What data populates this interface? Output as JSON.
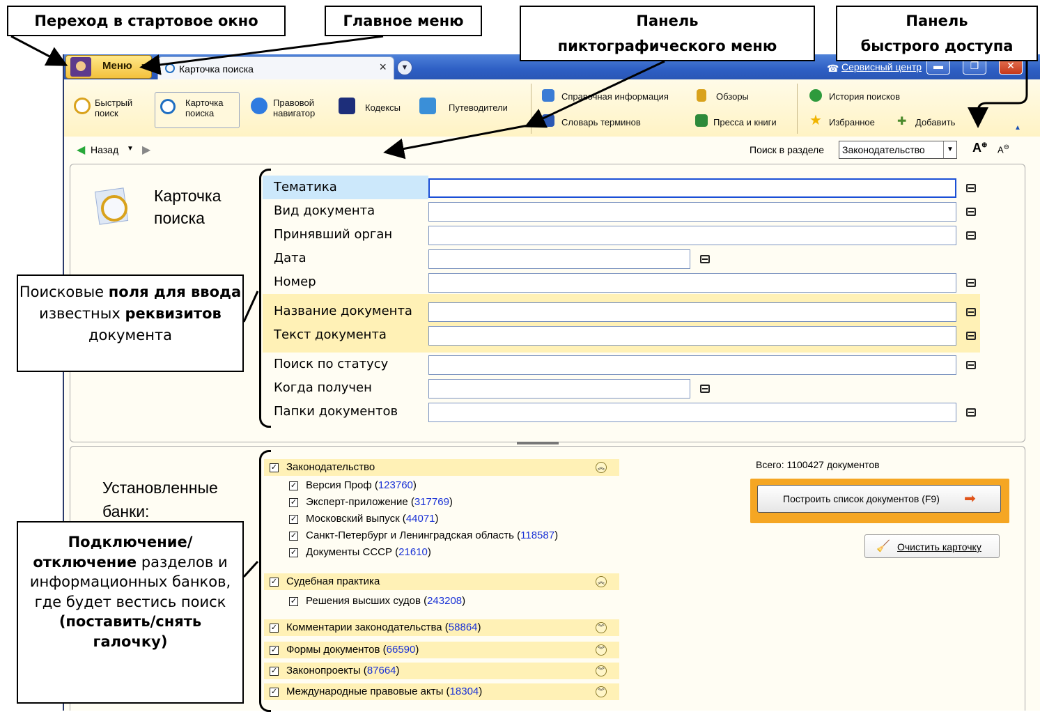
{
  "callouts": {
    "start_window": "Переход в стартовое окно",
    "main_menu": "Главное меню",
    "pictograph_panel": "Панель\nпиктографического меню",
    "quick_access": "Панель\nбыстрого доступа",
    "fields": {
      "p1": "Поисковые ",
      "b1": "поля для ввода",
      "p2": " известных ",
      "b2": "реквизитов",
      "p3": " документа"
    },
    "banks": {
      "b1": "Подключение/ отключение",
      "p1": " разделов и информационных банков, где будет вестись поиск ",
      "b2": "(поставить/снять галочку)"
    }
  },
  "titlebar": {
    "menu_label": "Меню",
    "tab_title": "Карточка поиска",
    "tab_close": "×",
    "service_center": "Сервисный центр"
  },
  "ribbon": {
    "quick_search": "Быстрый поиск",
    "search_card": "Карточка поиска",
    "legal_navigator": "Правовой навигатор",
    "codes": "Кодексы",
    "guides": "Путеводители",
    "reference_info": "Справочная информация",
    "terms_dictionary": "Словарь терминов",
    "reviews": "Обзоры",
    "press_books": "Пресса и книги",
    "search_history": "История поисков",
    "favorites": "Избранное",
    "add": "Добавить"
  },
  "nav": {
    "back": "Назад",
    "search_in_section_label": "Поиск в разделе",
    "section_value": "Законодательство"
  },
  "search_card": {
    "title_line1": "Карточка",
    "title_line2": "поиска",
    "fields": [
      "Тематика",
      "Вид документа",
      "Принявший орган",
      "Дата",
      "Номер",
      "Название документа",
      "Текст документа",
      "Поиск по статусу",
      "Когда получен",
      "Папки документов"
    ]
  },
  "banks": {
    "title_line1": "Установленные",
    "title_line2": "банки:",
    "total": "Всего: 1100427 документов",
    "build_button": "Построить список документов (F9)",
    "clear_button": "Очистить карточку",
    "groups": [
      {
        "name": "Законодательство",
        "count": ""
      },
      {
        "name": "Судебная практика",
        "count": ""
      },
      {
        "name": "Комментарии законодательства",
        "count": "58864"
      },
      {
        "name": "Формы документов",
        "count": "66590"
      },
      {
        "name": "Законопроекты",
        "count": "87664"
      },
      {
        "name": "Международные правовые акты",
        "count": "18304"
      }
    ],
    "sub": [
      {
        "name": "Версия Проф",
        "count": "123760"
      },
      {
        "name": "Эксперт-приложение",
        "count": "317769"
      },
      {
        "name": "Московский выпуск",
        "count": "44071"
      },
      {
        "name": "Санкт-Петербург и Ленинградская область",
        "count": "118587"
      },
      {
        "name": "Документы СССР",
        "count": "21610"
      },
      {
        "name": "Решения высших судов",
        "count": "243208"
      }
    ]
  },
  "colors": {
    "titlebar": "#2e5fc4",
    "ribbon": "#fff3c4",
    "highlight_rows": "#fff1b6",
    "build_button_border": "#f5a623",
    "link_numbers": "#1a32d6"
  }
}
